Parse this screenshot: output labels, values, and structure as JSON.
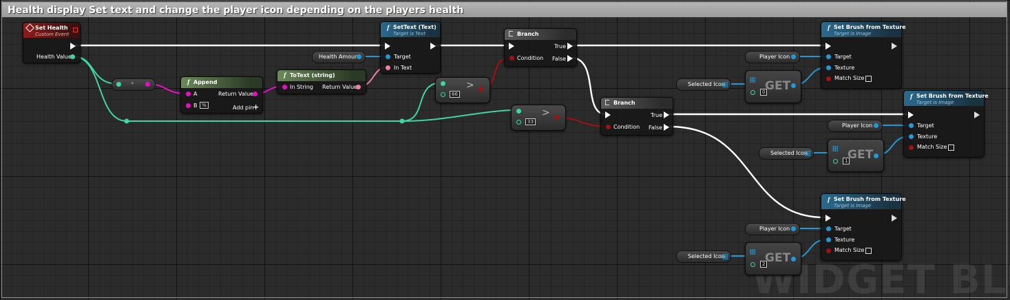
{
  "comment": {
    "title": "Health display Set text and change the player icon depending on the players health"
  },
  "watermark": "WIDGET BLU",
  "icons": {
    "function": "f",
    "branch": "branch-icon",
    "event": "event-diamond-icon",
    "array": "array-grid-icon"
  },
  "colors": {
    "exec": "#ffffff",
    "object": "#1e9ad8",
    "string": "#e60fc6",
    "integer": "#3fd5a4",
    "boolean": "#a31010",
    "text": "#f07fa9"
  },
  "set_health": {
    "title": "Set Health",
    "subtitle": "Custom Event",
    "pin_health": "Health Value"
  },
  "conv": {
    "dot": "•"
  },
  "append": {
    "title": "Append",
    "pin_a": "A",
    "pin_b": "B",
    "b_value": "%",
    "return": "Return Value",
    "add_pin": "Add pin",
    "add_icon": "+"
  },
  "totext": {
    "title": "ToText (string)",
    "pin_in": "In String",
    "return": "Return Value"
  },
  "settext": {
    "title": "SetText (Text)",
    "subtitle": "Target is Text",
    "pin_target": "Target",
    "pin_intext": "In Text"
  },
  "health_amount": {
    "label": "Health Amount"
  },
  "cmp66": {
    "value": "66"
  },
  "cmp33": {
    "value": "33"
  },
  "branch1": {
    "title": "Branch",
    "condition": "Condition",
    "true": "True",
    "false": "False"
  },
  "branch2": {
    "title": "Branch",
    "condition": "Condition",
    "true": "True",
    "false": "False"
  },
  "sbt1": {
    "title": "Set Brush from Texture",
    "subtitle": "Target is Image",
    "target": "Target",
    "texture": "Texture",
    "match": "Match Size"
  },
  "sbt2": {
    "title": "Set Brush from Texture",
    "subtitle": "Target is Image",
    "target": "Target",
    "texture": "Texture",
    "match": "Match Size"
  },
  "sbt3": {
    "title": "Set Brush from Texture",
    "subtitle": "Target is Image",
    "target": "Target",
    "texture": "Texture",
    "match": "Match Size"
  },
  "player_icon": {
    "label": "Player Icon"
  },
  "selected_icon": {
    "label": "Selected Icon"
  },
  "get": {
    "label": "GET"
  },
  "get0": {
    "index": "0"
  },
  "get1": {
    "index": "1"
  },
  "get2": {
    "index": "2"
  }
}
